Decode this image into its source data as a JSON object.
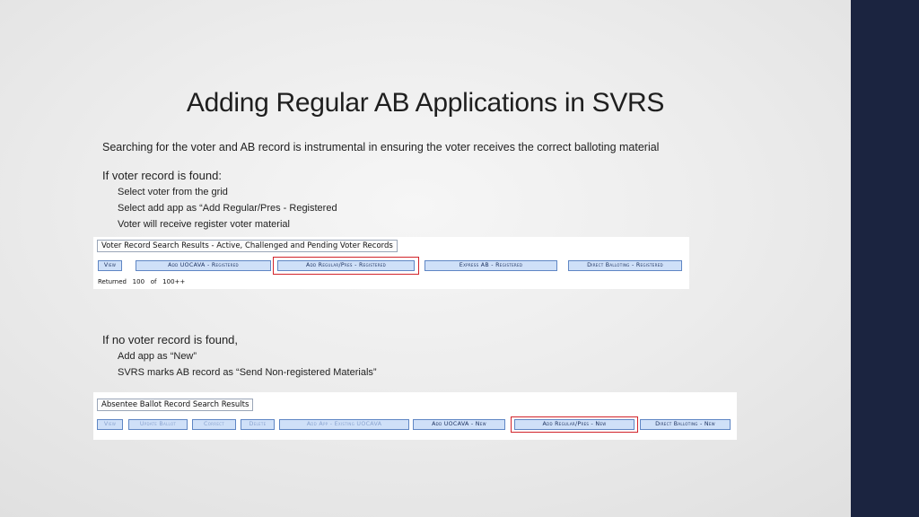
{
  "slide": {
    "title": "Adding Regular AB Applications in SVRS",
    "intro": "Searching for the voter and AB record is instrumental in ensuring the voter receives the correct balloting material"
  },
  "section_found": {
    "heading": "If voter record is found:",
    "bullets": [
      "Select voter from the grid",
      "Select add app as “Add Regular/Pres - Registered",
      "Voter will receive register voter material"
    ]
  },
  "voter_search_panel": {
    "title": "Voter Record Search Results - Active, Challenged and Pending Voter Records",
    "buttons": [
      "View",
      "Add UOCAVA - Registered",
      "Add Regular/Pres - Registered",
      "Express AB - Registered",
      "Direct Balloting - Registered"
    ],
    "returned_label": "Returned",
    "returned_count": "100",
    "of_label": "of",
    "total": "100++"
  },
  "section_not_found": {
    "heading": "If no voter record is found,",
    "bullets": [
      "Add app as “New”",
      "SVRS marks AB record as “Send Non-registered Materials”"
    ]
  },
  "ab_search_panel": {
    "title": "Absentee Ballot Record Search Results",
    "buttons": [
      "View",
      "Update Ballot",
      "Correct",
      "Delete",
      "Add App - Existing UOCAVA",
      "Add UOCAVA - New",
      "Add Regular/Pres - New",
      "Direct Balloting - New"
    ]
  },
  "colors": {
    "highlight": "#d2232a",
    "button_fill": "#cfe0f8",
    "button_border": "#5f86c4",
    "right_band": "#1b2440"
  }
}
